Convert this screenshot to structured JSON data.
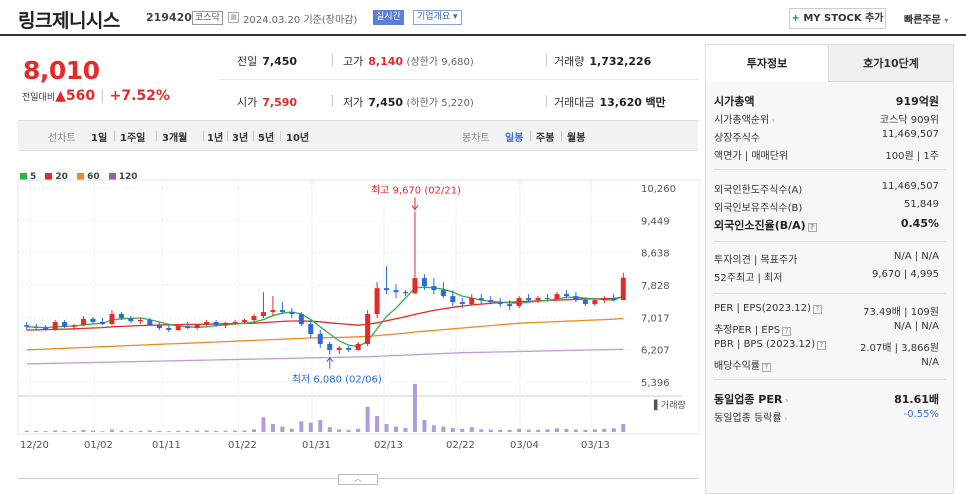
{
  "header": {
    "name": "링크제니시스",
    "code": "219420",
    "market": "코스닥",
    "date": "2024.03.20",
    "basis": "기준(장마감)",
    "live": "실시간",
    "corp": "기업개요",
    "mystock": "MY STOCK 추가",
    "mystock_plus": "+",
    "quick": "빠른주문"
  },
  "price": {
    "current": "8,010",
    "change_label": "전일대비",
    "change": "▲560",
    "change_pct": "+7.52%"
  },
  "stats": {
    "prev_label": "전일",
    "prev": "7,450",
    "open_label": "시가",
    "open": "7,590",
    "high_label": "고가",
    "high": "8,140",
    "high_sub": "(상한가 9,680)",
    "low_label": "저가",
    "low": "7,450",
    "low_sub": "(하한가 5,220)",
    "vol_label": "거래량",
    "vol": "1,732,226",
    "amt_label": "거래대금",
    "amt": "13,620",
    "amt_unit": "백만"
  },
  "range": {
    "line_label": "선차트",
    "line_opts": [
      "1일",
      "1주일",
      "3개월",
      "1년",
      "3년",
      "5년",
      "10년"
    ],
    "candle_label": "봉차트",
    "candle_opts": [
      "일봉",
      "주봉",
      "월봉"
    ],
    "candle_active": "일봉"
  },
  "legend": [
    {
      "label": "5",
      "color": "#e52a2a"
    },
    {
      "label": "20",
      "color": "#e52a2a"
    },
    {
      "label": "60",
      "color": "#f08a24"
    },
    {
      "label": "120",
      "color": "#9b59b6"
    }
  ],
  "sidebar": {
    "tab_active": "투자정보",
    "tab_other": "호가10단계",
    "rows": [
      {
        "k": "시가총액",
        "v": "919억원",
        "bold": true
      },
      {
        "k": "시가총액순위",
        "v": "코스닥 909위",
        "caret": true
      },
      {
        "k": "상장주식수",
        "v": "11,469,507"
      },
      {
        "k": "액면가 | 매매단위",
        "v": "100원 | 1주"
      },
      {
        "k": "외국인한도주식수(A)",
        "v": "11,469,507"
      },
      {
        "k": "외국인보유주식수(B)",
        "v": "51,849"
      },
      {
        "k": "외국인소진율(B/A)",
        "v": "0.45%",
        "bold": true,
        "q": true
      },
      {
        "k": "투자의견 | 목표주가",
        "v": "N/A | N/A"
      },
      {
        "k": "52주최고 | 최저",
        "v": "9,670 | 4,995"
      },
      {
        "k": "PER | EPS(2023.12)",
        "v": "73.49배 | 109원",
        "q": true
      },
      {
        "k": "추정PER | EPS",
        "v": "N/A | N/A",
        "q": true
      },
      {
        "k": "PBR | BPS (2023.12)",
        "v": "2.07배 | 3,866원",
        "q": true
      },
      {
        "k": "배당수익률",
        "v": "N/A",
        "q": true
      },
      {
        "k": "동일업종 PER",
        "v": "81.61배",
        "bold": true,
        "caret": true
      },
      {
        "k": "동일업종 등락률",
        "v": "-0.55%",
        "caret": true,
        "blue": true
      }
    ]
  },
  "chart_data": {
    "type": "candlestick",
    "y_ticks": [
      "10,260",
      "9,449",
      "8,638",
      "7,828",
      "7,017",
      "6,207",
      "5,396"
    ],
    "ylim": [
      5396,
      10260
    ],
    "x_ticks": [
      "12/20",
      "01/02",
      "01/11",
      "01/22",
      "01/31",
      "02/13",
      "02/22",
      "03/04",
      "03/13"
    ],
    "annotations": {
      "high": {
        "label": "최고 9,670 (02/21)",
        "value": 9670,
        "index": 41
      },
      "low": {
        "label": "최저 6,080 (02/06)",
        "value": 6080,
        "index": 32
      }
    },
    "volume_label": "거래량",
    "candles": [
      [
        6820,
        6900,
        6700,
        6780
      ],
      [
        6780,
        6850,
        6720,
        6760
      ],
      [
        6760,
        6820,
        6680,
        6700
      ],
      [
        6700,
        6950,
        6680,
        6900
      ],
      [
        6900,
        6950,
        6750,
        6780
      ],
      [
        6780,
        6850,
        6700,
        6820
      ],
      [
        6820,
        7050,
        6800,
        6980
      ],
      [
        6980,
        7020,
        6850,
        6900
      ],
      [
        6900,
        7000,
        6820,
        6850
      ],
      [
        6850,
        7200,
        6820,
        7100
      ],
      [
        7100,
        7150,
        6950,
        7000
      ],
      [
        7000,
        7050,
        6880,
        6920
      ],
      [
        6920,
        7000,
        6850,
        6950
      ],
      [
        6950,
        7000,
        6800,
        6830
      ],
      [
        6830,
        6900,
        6700,
        6750
      ],
      [
        6750,
        6820,
        6650,
        6700
      ],
      [
        6700,
        6820,
        6680,
        6800
      ],
      [
        6800,
        6900,
        6720,
        6750
      ],
      [
        6750,
        6850,
        6700,
        6830
      ],
      [
        6830,
        6950,
        6800,
        6900
      ],
      [
        6900,
        6950,
        6780,
        6820
      ],
      [
        6820,
        6900,
        6750,
        6880
      ],
      [
        6880,
        6950,
        6820,
        6900
      ],
      [
        6900,
        6980,
        6850,
        6950
      ],
      [
        6950,
        7100,
        6900,
        7050
      ],
      [
        7050,
        7650,
        7000,
        7150
      ],
      [
        7150,
        7550,
        7050,
        7200
      ],
      [
        7200,
        7400,
        7100,
        7150
      ],
      [
        7150,
        7250,
        7000,
        7100
      ],
      [
        7100,
        7150,
        6800,
        6850
      ],
      [
        6850,
        6950,
        6500,
        6600
      ],
      [
        6600,
        6700,
        6250,
        6350
      ],
      [
        6350,
        6400,
        6080,
        6200
      ],
      [
        6200,
        6300,
        6100,
        6250
      ],
      [
        6250,
        6300,
        6150,
        6200
      ],
      [
        6200,
        6400,
        6180,
        6350
      ],
      [
        6350,
        7200,
        6300,
        7100
      ],
      [
        7100,
        7900,
        7000,
        7750
      ],
      [
        7750,
        8300,
        7600,
        7700
      ],
      [
        7700,
        7850,
        7500,
        7650
      ],
      [
        7650,
        7700,
        7550,
        7620
      ],
      [
        7620,
        9670,
        7600,
        8000
      ],
      [
        8000,
        8100,
        7700,
        7800
      ],
      [
        7800,
        8000,
        7600,
        7700
      ],
      [
        7700,
        7900,
        7500,
        7550
      ],
      [
        7550,
        7700,
        7300,
        7400
      ],
      [
        7400,
        7500,
        7250,
        7350
      ],
      [
        7350,
        7600,
        7300,
        7500
      ],
      [
        7500,
        7600,
        7350,
        7450
      ],
      [
        7450,
        7550,
        7350,
        7400
      ],
      [
        7400,
        7500,
        7280,
        7350
      ],
      [
        7350,
        7450,
        7200,
        7300
      ],
      [
        7300,
        7550,
        7250,
        7500
      ],
      [
        7500,
        7600,
        7400,
        7450
      ],
      [
        7450,
        7550,
        7380,
        7500
      ],
      [
        7500,
        7600,
        7420,
        7480
      ],
      [
        7480,
        7650,
        7450,
        7600
      ],
      [
        7600,
        7700,
        7500,
        7550
      ],
      [
        7550,
        7650,
        7400,
        7450
      ],
      [
        7450,
        7500,
        7300,
        7350
      ],
      [
        7350,
        7500,
        7300,
        7450
      ],
      [
        7450,
        7550,
        7380,
        7500
      ],
      [
        7500,
        7600,
        7420,
        7450
      ],
      [
        7450,
        8140,
        7450,
        8010
      ]
    ],
    "ma5": [
      6780,
      6770,
      6760,
      6780,
      6790,
      6800,
      6830,
      6850,
      6870,
      6950,
      6980,
      6990,
      7000,
      6960,
      6900,
      6840,
      6800,
      6780,
      6770,
      6780,
      6810,
      6830,
      6850,
      6870,
      6900,
      6960,
      7060,
      7120,
      7150,
      7100,
      6960,
      6780,
      6600,
      6430,
      6320,
      6280,
      6420,
      6730,
      7040,
      7250,
      7500,
      7760,
      7770,
      7760,
      7720,
      7650,
      7550,
      7500,
      7450,
      7420,
      7400,
      7380,
      7370,
      7400,
      7420,
      7440,
      7480,
      7520,
      7520,
      7500,
      7480,
      7460,
      7450,
      7550
    ],
    "ma20": [
      6700,
      6705,
      6710,
      6715,
      6720,
      6730,
      6740,
      6750,
      6760,
      6780,
      6790,
      6800,
      6810,
      6820,
      6825,
      6830,
      6835,
      6840,
      6840,
      6845,
      6850,
      6855,
      6860,
      6865,
      6870,
      6885,
      6900,
      6915,
      6925,
      6925,
      6920,
      6905,
      6880,
      6860,
      6840,
      6820,
      6840,
      6880,
      6930,
      6980,
      7030,
      7090,
      7140,
      7190,
      7230,
      7270,
      7300,
      7330,
      7350,
      7370,
      7390,
      7400,
      7410,
      7420,
      7430,
      7440,
      7450,
      7460,
      7470,
      7475,
      7480,
      7485,
      7490,
      7530
    ],
    "ma60": [
      6200,
      6210,
      6220,
      6230,
      6240,
      6250,
      6260,
      6270,
      6280,
      6290,
      6300,
      6310,
      6320,
      6330,
      6340,
      6350,
      6360,
      6370,
      6380,
      6390,
      6400,
      6410,
      6420,
      6430,
      6440,
      6450,
      6460,
      6470,
      6480,
      6490,
      6500,
      6505,
      6510,
      6515,
      6520,
      6530,
      6540,
      6560,
      6580,
      6600,
      6620,
      6650,
      6670,
      6690,
      6710,
      6730,
      6750,
      6770,
      6790,
      6810,
      6830,
      6850,
      6870,
      6880,
      6890,
      6900,
      6910,
      6920,
      6930,
      6940,
      6950,
      6960,
      6970,
      6990
    ],
    "ma120": [
      5850,
      5855,
      5860,
      5865,
      5870,
      5875,
      5880,
      5885,
      5890,
      5895,
      5900,
      5905,
      5910,
      5915,
      5920,
      5925,
      5930,
      5935,
      5940,
      5945,
      5950,
      5955,
      5960,
      5965,
      5970,
      5975,
      5980,
      5985,
      5990,
      5995,
      6000,
      6005,
      6010,
      6015,
      6020,
      6025,
      6030,
      6040,
      6050,
      6060,
      6070,
      6080,
      6090,
      6100,
      6110,
      6120,
      6130,
      6135,
      6140,
      6145,
      6150,
      6155,
      6160,
      6165,
      6170,
      6175,
      6180,
      6185,
      6190,
      6195,
      6200,
      6205,
      6210,
      6215
    ],
    "volumes": [
      5,
      4,
      3,
      6,
      4,
      4,
      8,
      5,
      3,
      9,
      5,
      4,
      4,
      6,
      4,
      3,
      5,
      4,
      5,
      6,
      4,
      5,
      5,
      6,
      10,
      55,
      30,
      20,
      12,
      40,
      35,
      45,
      18,
      10,
      8,
      12,
      95,
      60,
      30,
      20,
      15,
      180,
      45,
      25,
      20,
      15,
      12,
      18,
      10,
      9,
      8,
      8,
      12,
      9,
      8,
      10,
      14,
      11,
      9,
      8,
      10,
      12,
      14,
      30
    ]
  }
}
